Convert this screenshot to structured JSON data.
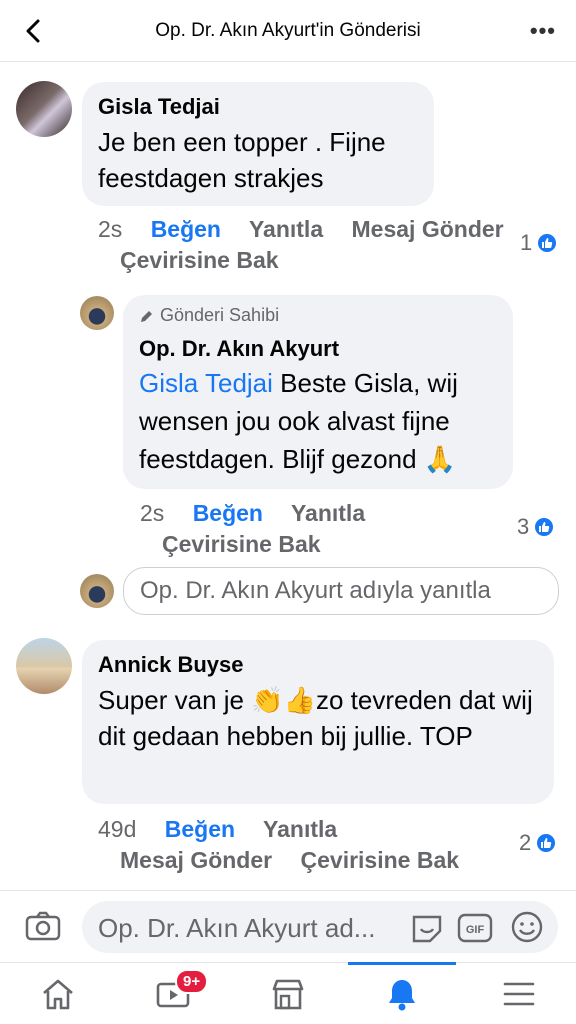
{
  "header": {
    "title": "Op. Dr. Akın Akyurt'in Gönderisi",
    "more": "•••"
  },
  "comments": [
    {
      "author": "Gisla Tedjai",
      "text": "Je ben een topper . Fijne feestdagen strakjes",
      "time": "2s",
      "actions": {
        "like": "Beğen",
        "reply": "Yanıtla",
        "message": "Mesaj Gönder",
        "translate": "Çevirisine Bak"
      },
      "reactions": "1"
    },
    {
      "tag": "Gönderi Sahibi",
      "author": "Op. Dr. Akın Akyurt",
      "mention": "Gisla Tedjai",
      "text": " Beste Gisla, wij wensen jou ook alvast fijne feestdagen. Blijf gezond 🙏",
      "time": "2s",
      "actions": {
        "like": "Beğen",
        "reply": "Yanıtla",
        "translate": "Çevirisine Bak"
      },
      "reactions": "3"
    },
    {
      "author": "Annick Buyse",
      "text": "Super van je 👏👍zo tevreden dat wij dit gedaan hebben bij jullie. TOP",
      "time": "49d",
      "actions": {
        "like": "Beğen",
        "reply": "Yanıtla",
        "message": "Mesaj Gönder",
        "translate": "Çevirisine Bak"
      },
      "reactions": "2"
    }
  ],
  "reply_box": {
    "placeholder": "Op. Dr. Akın Akyurt adıyla yanıtla"
  },
  "composer": {
    "placeholder": "Op. Dr. Akın Akyurt ad..."
  },
  "tabbar": {
    "items": [
      "home-icon",
      "watch-icon",
      "marketplace-icon",
      "notifications-icon",
      "menu-icon"
    ],
    "watch_badge": "9+"
  },
  "colors": {
    "accent": "#1877f2",
    "bubble": "#f0f2f5",
    "badge": "#e41e3f"
  }
}
